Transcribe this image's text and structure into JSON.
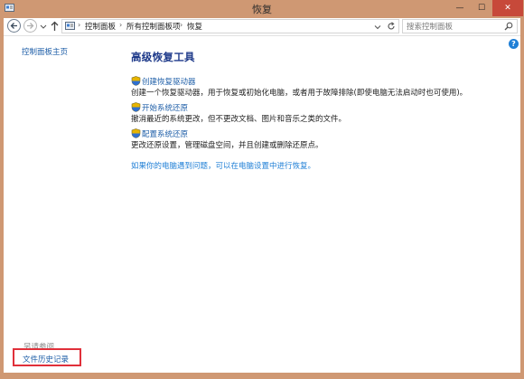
{
  "window": {
    "title": "恢复",
    "minimize_glyph": "—",
    "maximize_glyph": "☐",
    "close_glyph": "✕"
  },
  "addressbar": {
    "breadcrumbs": [
      "控制面板",
      "所有控制面板项",
      "恢复"
    ],
    "separator": "›",
    "search_placeholder": "搜索控制面板"
  },
  "sidebar": {
    "home_link": "控制面板主页",
    "see_also_label": "另请参阅",
    "see_also_items": [
      "文件历史记录"
    ]
  },
  "main": {
    "title": "高级恢复工具",
    "tools": [
      {
        "link": "创建恢复驱动器",
        "description": "创建一个恢复驱动器，用于恢复或初始化电脑，或者用于故障排除(即使电脑无法启动时也可使用)。"
      },
      {
        "link": "开始系统还原",
        "description": "撤消最近的系统更改，但不更改文档、图片和音乐之类的文件。"
      },
      {
        "link": "配置系统还原",
        "description": "更改还原设置，管理磁盘空间，并且创建或删除还原点。"
      }
    ],
    "pc_settings_link": "如果你的电脑遇到问题，可以在电脑设置中进行恢复。"
  },
  "colors": {
    "window_frame": "#cf9873",
    "link": "#1f5fa8",
    "title": "#1e3a8a",
    "close_button": "#c7493a",
    "highlight_box": "#e0303a"
  },
  "icons": {
    "back": "back-arrow-icon",
    "forward": "forward-arrow-icon",
    "up": "up-arrow-icon",
    "refresh": "refresh-icon",
    "search": "search-icon",
    "help": "help-icon",
    "shield": "uac-shield-icon"
  }
}
